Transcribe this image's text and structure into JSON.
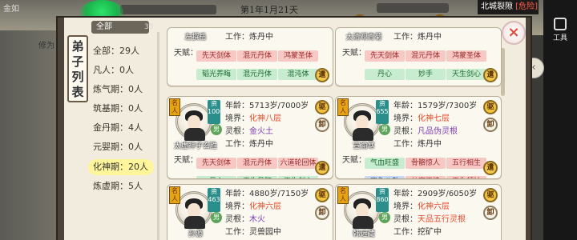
{
  "scene": {
    "top_left_label": "金如",
    "date": "第1年1月21天",
    "map_name": "北城裂隙",
    "map_status": "[危险]"
  },
  "system": {
    "tool_label": "工具"
  },
  "left_side": {
    "label": "修为"
  },
  "panel": {
    "title": "弟子列表",
    "filter": "全部",
    "filter_count": "35",
    "close_icon": "×"
  },
  "realms": [
    {
      "label": "全部：29人",
      "active": false
    },
    {
      "label": "凡人：0人",
      "active": false
    },
    {
      "label": "炼气期：0人",
      "active": false
    },
    {
      "label": "筑基期：0人",
      "active": false
    },
    {
      "label": "金丹期：4人",
      "active": false
    },
    {
      "label": "元婴期：0人",
      "active": false
    },
    {
      "label": "化神期：20人",
      "active": true
    },
    {
      "label": "炼虚期：5人",
      "active": false
    }
  ],
  "partial_cards": [
    {
      "name": "左撰岳",
      "work_label": "工作：",
      "work": "炼丹中",
      "talent_label": "天赋：",
      "talents": [
        {
          "text": "先天剑体",
          "tone": "pink"
        },
        {
          "text": "混元丹体",
          "tone": "pink"
        },
        {
          "text": "鸿蒙圣体",
          "tone": "pink"
        },
        {
          "text": "韬光养晦",
          "tone": "green"
        },
        {
          "text": "混元丹体",
          "tone": "green"
        },
        {
          "text": "混沌体",
          "tone": "green"
        }
      ],
      "button": "遣"
    },
    {
      "name": "太清观青菊",
      "work_label": "工作：",
      "work": "炼丹中",
      "talent_label": "天赋：",
      "talents": [
        {
          "text": "先天剑体",
          "tone": "pink"
        },
        {
          "text": "混元丹体",
          "tone": "pink"
        },
        {
          "text": "鸿蒙圣体",
          "tone": "pink"
        },
        {
          "text": "丹心",
          "tone": "green"
        },
        {
          "text": "妙手",
          "tone": "green"
        },
        {
          "text": "天生剑心",
          "tone": "green"
        }
      ],
      "button": "遣"
    }
  ],
  "cards": [
    {
      "name": "太虚神子玄胜",
      "rank": "名人",
      "level": "资1000",
      "gender": "男",
      "age_label": "年龄：",
      "age": "5713岁/7000岁",
      "realm_label": "境界：",
      "realm": "化神八层",
      "root_label": "灵根：",
      "root": "金火土",
      "work_label": "工作：",
      "work": "炼丹中",
      "talent_label": "天赋：",
      "talents": [
        {
          "text": "先天剑体",
          "tone": "pink"
        },
        {
          "text": "混元丹体",
          "tone": "pink"
        },
        {
          "text": "六道轮回体",
          "tone": "pink"
        },
        {
          "text": "丹心",
          "tone": "green"
        },
        {
          "text": "天生丹胚",
          "tone": "green"
        },
        {
          "text": "天生剑心",
          "tone": "green"
        }
      ],
      "side_buttons": [
        "驱",
        "卸"
      ],
      "bottom_button": "遣"
    },
    {
      "name": "宣渝寒",
      "rank": "名人",
      "level": "资655",
      "gender": "男",
      "age_label": "年龄：",
      "age": "1579岁/7300岁",
      "realm_label": "境界：",
      "realm": "化神七层",
      "root_label": "灵根：",
      "root": "凡品伪灵根",
      "work_label": "工作：",
      "work": "炼丹中",
      "talent_label": "天赋：",
      "talents": [
        {
          "text": "气血旺盛",
          "tone": "green"
        },
        {
          "text": "骨骼惊人",
          "tone": "pink"
        },
        {
          "text": "五行相生",
          "tone": "pink"
        },
        {
          "text": "四象八卦",
          "tone": "blue"
        },
        {
          "text": "从容不迫",
          "tone": "pink"
        },
        {
          "text": "天生领袖",
          "tone": "pink"
        }
      ],
      "side_buttons": [
        "驱",
        "卸"
      ],
      "bottom_button": "遣"
    },
    {
      "name": "孙源",
      "rank": "名人",
      "level": "资463",
      "gender": "男",
      "age_label": "年龄：",
      "age": "4880岁/7150岁",
      "realm_label": "境界：",
      "realm": "化神六层",
      "root_label": "灵根：",
      "root": "木火",
      "work_label": "工作：",
      "work": "灵兽园中",
      "side_buttons": [
        "驱",
        "卸"
      ]
    },
    {
      "name": "韩远藏",
      "rank": "名人",
      "level": "资860",
      "gender": "男",
      "age_label": "年龄：",
      "age": "2909岁/6050岁",
      "realm_label": "境界：",
      "realm": "化神六层",
      "root_label": "灵根：",
      "root": "天品五行灵根",
      "work_label": "工作：",
      "work": "挖矿中",
      "side_buttons": [
        "驱",
        "卸"
      ]
    }
  ],
  "colors": {
    "panel_bg": "#f1ecdd",
    "active_realm": "#fff59a",
    "realm_red": "#e74a2b",
    "root_purple": "#7b3bb0",
    "danger": "#ff5c4a"
  }
}
